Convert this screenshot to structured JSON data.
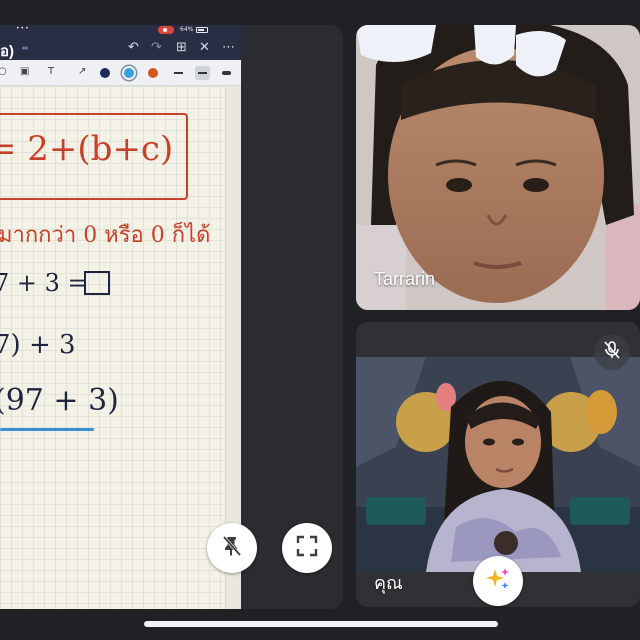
{
  "shared_screen": {
    "status_bar": {
      "dots": "•••",
      "status_text": "64%"
    },
    "notes_app": {
      "title": "อ)",
      "title_extra": "✏",
      "toolbar_colors": [
        "#1e2a5a",
        "#3aa0e0",
        "#d2561e"
      ],
      "page_lines": {
        "formula": "= 2+(b+c)",
        "thai_note": "มากกว่า 0 หรือ 0 ก็ได้",
        "eq_line_1": "7 + 3 =",
        "eq_line_2": "7) + 3",
        "eq_line_3": "(97 + 3)"
      }
    },
    "controls": {
      "unpin_icon": "pin-off-icon",
      "fullscreen_icon": "fullscreen-icon"
    }
  },
  "participants": [
    {
      "name": "Tarrarin",
      "muted": false
    },
    {
      "name": "คุณ",
      "muted": true
    }
  ],
  "effects_icon": "sparkle-icon"
}
